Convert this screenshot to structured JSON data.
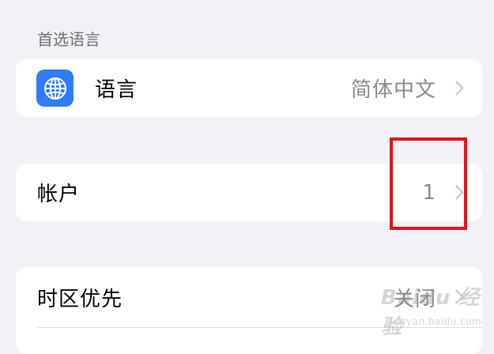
{
  "section_header": "首选语言",
  "language_row": {
    "icon": "globe-icon",
    "icon_color": "#2f7cf6",
    "label": "语言",
    "value": "简体中文"
  },
  "account_row": {
    "label": "帐户",
    "value": "1"
  },
  "timezone_row": {
    "label": "时区优先",
    "value": "关闭"
  },
  "highlight_color": "#e1141b",
  "watermark": {
    "main": "Baidu 经验",
    "sub": "jingyan.baidu.com"
  }
}
